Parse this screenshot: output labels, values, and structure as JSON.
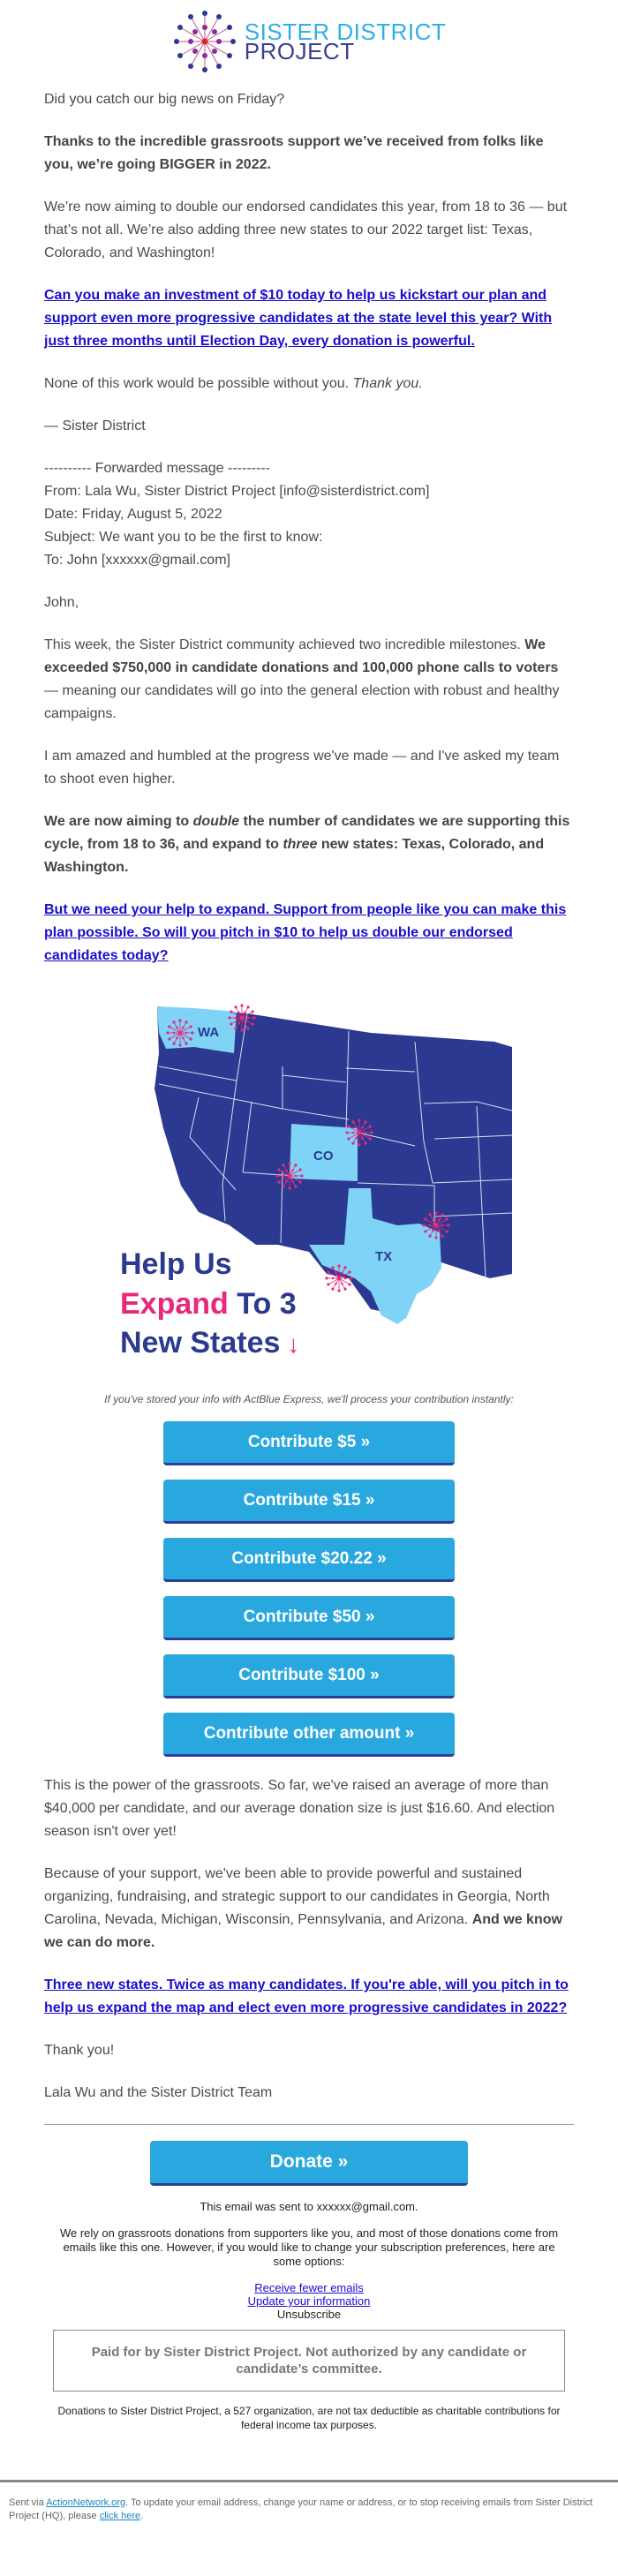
{
  "brand": {
    "logo_line1": "SISTER DISTRICT",
    "logo_line2": "PROJECT",
    "colors": {
      "accent_blue": "#29a8e0",
      "navy": "#2b3990",
      "pink": "#e8297b",
      "light_blue": "#7fd3f7",
      "link": "#1a0dcc"
    }
  },
  "intro": {
    "p1": "Did you catch our big news on Friday?",
    "p2_bold": "Thanks to the incredible grassroots support we’ve received from folks like you, we’re going BIGGER in 2022.",
    "p3": "We’re now aiming to double our endorsed candidates this year, from 18 to 36 — but that’s not all. We’re also adding three new states to our 2022 target list: Texas, Colorado, and Washington!",
    "p4_link": "Can you make an investment of $10 today to help us kickstart our plan and support even more progressive candidates at the state level this year? With just three months until Election Day, every donation is powerful.",
    "p5_text": "None of this work would be possible without you. ",
    "p5_italic": "Thank you.",
    "signoff": "— Sister District"
  },
  "forwarded": {
    "header": "---------- Forwarded message ---------",
    "from": "From: Lala Wu, Sister District Project [info@sisterdistrict.com]",
    "date": "Date: Friday, August 5, 2022",
    "subject": "Subject: We want you to be the first to know:",
    "to": "To: John [xxxxxx@gmail.com]"
  },
  "body": {
    "greeting": "John,",
    "m1_text": "This week, the Sister District community achieved two incredible milestones. ",
    "m1_bold": "We exceeded $750,000 in candidate donations and 100,000 phone calls to voters",
    "m1_tail": " — meaning our candidates will go into the general election with robust and healthy campaigns.",
    "m2": "I am amazed and humbled at the progress we've made — and I've asked my team to shoot even higher.",
    "m3_a": "We are now aiming to ",
    "m3_i1": "double",
    "m3_b": " the number of candidates we are supporting this cycle, from 18 to 36, and expand to ",
    "m3_i2": "three",
    "m3_c": " new states: Texas, Colorado, and Washington.",
    "m4_link": "But we need your help to expand. Support from people like you can make this plan possible. So will you pitch in $10 to help us double our endorsed candidates today?"
  },
  "map": {
    "states": [
      "WA",
      "CO",
      "TX"
    ],
    "headline_1": "Help Us",
    "headline_2a": "Expand",
    "headline_2b": " To 3",
    "headline_3": "New States",
    "arrow": "↓"
  },
  "contribute": {
    "note": "If you've stored your info with ActBlue Express, we'll process your contribution instantly:",
    "buttons": [
      "Contribute $5 »",
      "Contribute $15 »",
      "Contribute $20.22 »",
      "Contribute $50 »",
      "Contribute $100 »",
      "Contribute other amount »"
    ]
  },
  "closing": {
    "c1": "This is the power of the grassroots. So far, we've raised an average of more than $40,000 per candidate, and our average donation size is just $16.60. And election season isn't over yet!",
    "c2_text": "Because of your support, we've been able to provide powerful and sustained organizing, fundraising, and strategic support to our candidates in Georgia, North Carolina, Nevada, Michigan, Wisconsin, Pennsylvania, and Arizona. ",
    "c2_bold": "And we know we can do more.",
    "c3_link": "Three new states. Twice as many candidates. If you're able, will you pitch in to help us expand the map and elect even more progressive candidates in 2022?",
    "thanks": "Thank you!",
    "signature": "Lala Wu and the Sister District Team"
  },
  "footer": {
    "donate_label": "Donate »",
    "sent_to": "This email was sent to xxxxxx@gmail.com.",
    "rely": "We rely on grassroots donations from supporters like you, and most of those donations come from emails like this one. However, if you would like to change your subscription preferences, here are some options:",
    "fewer_emails": "Receive fewer emails",
    "update_info": "Update your information",
    "unsubscribe": "Unsubscribe",
    "paid_for": "Paid for by Sister District Project. Not authorized by any candidate or candidate’s committee.",
    "tax": "Donations to Sister District Project, a 527 organization, are not tax deductible as charitable contributions for federal income tax purposes.",
    "sent_via_a": "Sent via ",
    "sent_via_link": "ActionNetwork.org",
    "sent_via_b": ". To update your email address, change your name or address, or to stop receiving emails from Sister District Project (HQ), please ",
    "click_here": "click here",
    "sent_via_c": "."
  }
}
